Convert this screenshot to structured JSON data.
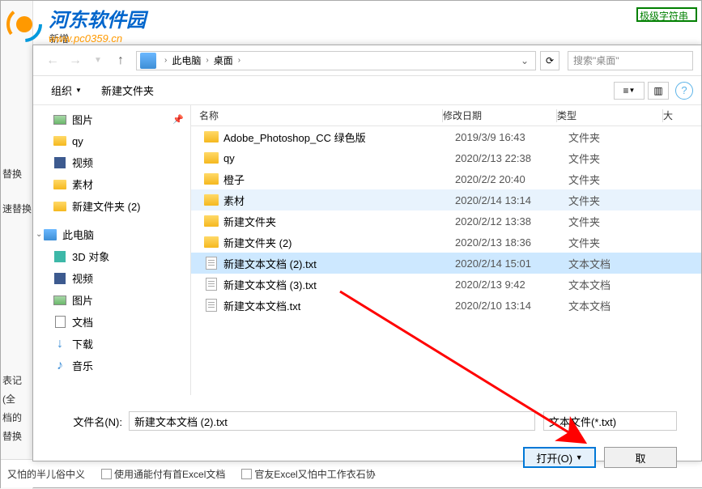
{
  "watermark": {
    "title": "河东软件园",
    "url": "www.pc0359.cn"
  },
  "bg": {
    "title": "新增",
    "topright": "极级字符串",
    "left_labels": [
      "替换",
      "速替换"
    ],
    "bottom1": "表记",
    "bottom2": "(全",
    "bottom3": "档的",
    "bottom4": "替换",
    "bottom5": "又怕的半儿俗中义",
    "bottom_chk1": "使用通能付有首Excel文档",
    "bottom_chk2": "官友Excel又怕中工作衣石协"
  },
  "nav": {
    "crumb1": "此电脑",
    "crumb2": "桌面",
    "search_placeholder": "搜索\"桌面\""
  },
  "toolbar": {
    "organize": "组织",
    "newfolder": "新建文件夹"
  },
  "sidebar": {
    "items": [
      {
        "label": "图片",
        "type": "img",
        "pinned": true
      },
      {
        "label": "qy",
        "type": "folder"
      },
      {
        "label": "视频",
        "type": "video"
      },
      {
        "label": "素材",
        "type": "folder"
      },
      {
        "label": "新建文件夹 (2)",
        "type": "folder"
      }
    ],
    "pc_label": "此电脑",
    "pc_items": [
      {
        "label": "3D 对象",
        "type": "obj"
      },
      {
        "label": "视频",
        "type": "video"
      },
      {
        "label": "图片",
        "type": "img"
      },
      {
        "label": "文档",
        "type": "doc"
      },
      {
        "label": "下载",
        "type": "dl"
      },
      {
        "label": "音乐",
        "type": "music"
      }
    ]
  },
  "columns": {
    "name": "名称",
    "date": "修改日期",
    "type": "类型",
    "size": "大"
  },
  "files": [
    {
      "name": "Adobe_Photoshop_CC  绿色版",
      "date": "2019/3/9 16:43",
      "type": "文件夹",
      "icon": "folder"
    },
    {
      "name": "qy",
      "date": "2020/2/13 22:38",
      "type": "文件夹",
      "icon": "folder"
    },
    {
      "name": "橙子",
      "date": "2020/2/2 20:40",
      "type": "文件夹",
      "icon": "folder"
    },
    {
      "name": "素材",
      "date": "2020/2/14 13:14",
      "type": "文件夹",
      "icon": "folder",
      "highlighted": true
    },
    {
      "name": "新建文件夹",
      "date": "2020/2/12 13:38",
      "type": "文件夹",
      "icon": "folder"
    },
    {
      "name": "新建文件夹 (2)",
      "date": "2020/2/13 18:36",
      "type": "文件夹",
      "icon": "folder"
    },
    {
      "name": "新建文本文档 (2).txt",
      "date": "2020/2/14 15:01",
      "type": "文本文档",
      "icon": "txt",
      "selected": true
    },
    {
      "name": "新建文本文档 (3).txt",
      "date": "2020/2/13 9:42",
      "type": "文本文档",
      "icon": "txt"
    },
    {
      "name": "新建文本文档.txt",
      "date": "2020/2/10 13:14",
      "type": "文本文档",
      "icon": "txt"
    }
  ],
  "filename": {
    "label": "文件名(N):",
    "value": "新建文本文档 (2).txt",
    "filter": "文本文件(*.txt)"
  },
  "buttons": {
    "open": "打开(O)",
    "cancel": "取"
  }
}
